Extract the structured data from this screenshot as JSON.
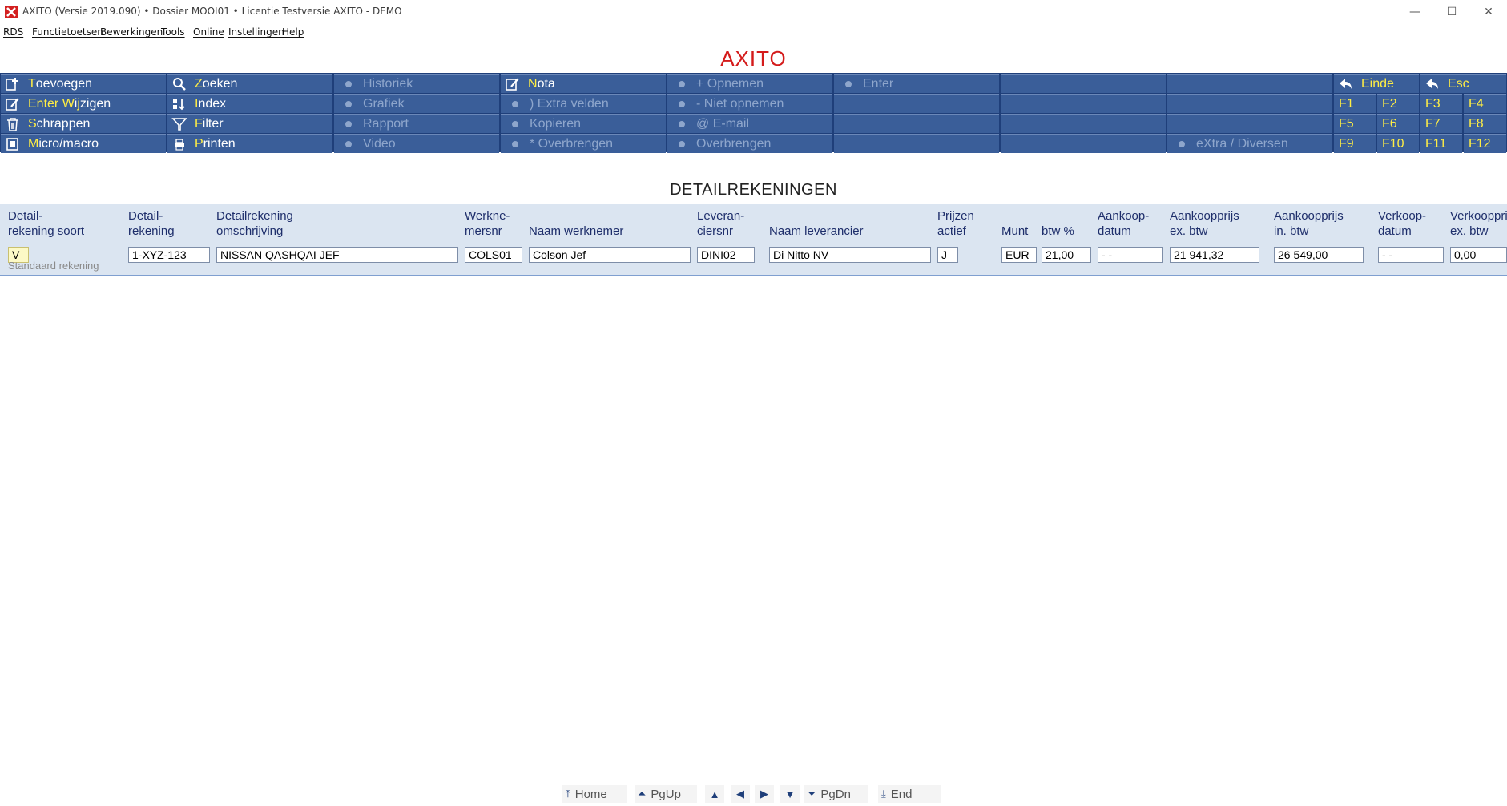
{
  "window": {
    "title": "AXITO  (Versie 2019.090)  •  Dossier MOOI01  •  Licentie Testversie AXITO - DEMO",
    "controls": {
      "minimize": "—",
      "maximize": "☐",
      "close": "✕"
    }
  },
  "menu": {
    "items": [
      "RDS",
      "Functietoetsen",
      "Bewerkingen",
      "Tools",
      "Online",
      "Instellingen",
      "Help"
    ]
  },
  "app_title": "AXITO",
  "toolbar": {
    "toevoegen": {
      "hk": "T",
      "rest": "oevoegen"
    },
    "wijzigen": {
      "hk": "Enter W",
      "mid": "i",
      "hk2": "j",
      "rest": "zigen"
    },
    "schrappen": {
      "hk": "S",
      "rest": "chrappen"
    },
    "micro": {
      "hk": "M",
      "rest": "icro/macro"
    },
    "zoeken": {
      "hk": "Z",
      "rest": "oeken"
    },
    "index": {
      "hk": "I",
      "rest": "ndex"
    },
    "filter": {
      "hk": "F",
      "rest": "ilter"
    },
    "printen": {
      "hk": "P",
      "rest": "rinten"
    },
    "historiek": "Historiek",
    "grafiek": "Grafiek",
    "rapport": "Rapport",
    "video": "Video",
    "nota": {
      "hk": "N",
      "rest": "ota"
    },
    "extra_velden": ") Extra velden",
    "kopieren": "Kopieren",
    "overbrengen_star": "*  Overbrengen",
    "opnemen": "+  Opnemen",
    "niet_opnemen": "-  Niet opnemen",
    "email": "@ E-mail",
    "overbrengen": "Overbrengen",
    "enter": "Enter",
    "extra_diversen": "eXtra / Diversen",
    "einde": "Einde",
    "esc": "Esc",
    "fkeys": [
      "F1",
      "F2",
      "F3",
      "F4",
      "F5",
      "F6",
      "F7",
      "F8",
      "F9",
      "F10",
      "F11",
      "F12"
    ]
  },
  "section_title": "DETAILREKENINGEN",
  "record": {
    "columns": [
      {
        "h1": "Detail-",
        "h2": "rekening soort",
        "value": "V"
      },
      {
        "h1": "Detail-",
        "h2": "rekening",
        "value": "1-XYZ-123"
      },
      {
        "h1": "Detailrekening",
        "h2": "omschrijving",
        "value": "NISSAN QASHQAI JEF"
      },
      {
        "h1": "Werkne-",
        "h2": "mersnr",
        "value": "COLS01"
      },
      {
        "h1": "",
        "h2": "Naam werknemer",
        "value": "Colson Jef"
      },
      {
        "h1": "Leveran-",
        "h2": "ciersnr",
        "value": "DINI02"
      },
      {
        "h1": "",
        "h2": "Naam leverancier",
        "value": "Di Nitto NV"
      },
      {
        "h1": "Prijzen",
        "h2": "actief",
        "value": "J"
      },
      {
        "h1": "",
        "h2": "Munt",
        "value": "EUR"
      },
      {
        "h1": "",
        "h2": "btw %",
        "value": "21,00"
      },
      {
        "h1": "Aankoop-",
        "h2": "datum",
        "value": "- -"
      },
      {
        "h1": "Aankoopprijs",
        "h2": "ex. btw",
        "value": "21 941,32"
      },
      {
        "h1": "Aankoopprijs",
        "h2": "in. btw",
        "value": "26 549,00"
      },
      {
        "h1": "Verkoop-",
        "h2": "datum",
        "value": "- -"
      },
      {
        "h1": "Verkoopprijs",
        "h2": "ex. btw",
        "value": "0,00"
      }
    ],
    "soort_label": "Standaard rekening"
  },
  "nav": {
    "home": "Home",
    "pgup": "PgUp",
    "pgdn": "PgDn",
    "end": "End"
  }
}
